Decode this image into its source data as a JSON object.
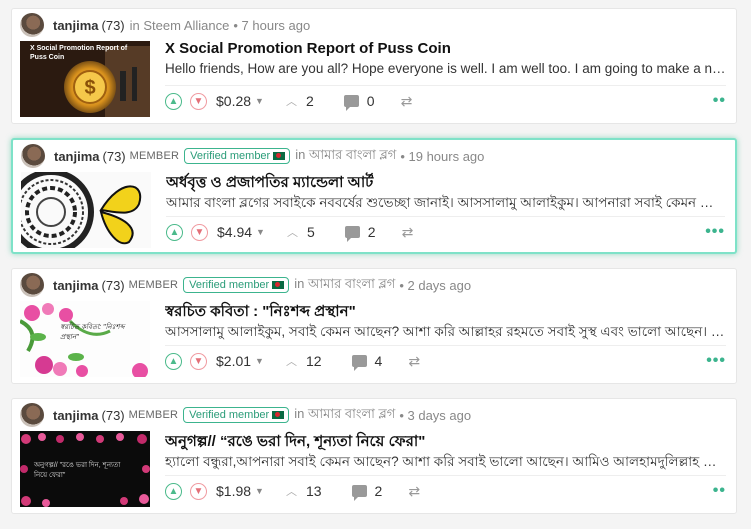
{
  "posts": [
    {
      "author": "tanjima",
      "reputation": "(73)",
      "member_label": "",
      "verified_label": "",
      "community_prefix": "in Steem Alliance",
      "time": "• 7 hours ago",
      "title": "X Social Promotion Report of Puss Coin",
      "body": "Hello friends, How are you all? Hope everyone is well. I am well too. I am going to make a new report on X social promotion of Puss Coin.",
      "thumb_caption": "X Social Promotion Report of Puss Coin",
      "payout": "$0.28",
      "votes": "2",
      "comments": "0",
      "more": "••"
    },
    {
      "author": "tanjima",
      "reputation": "(73)",
      "member_label": "MEMBER",
      "verified_label": "Verified member",
      "community_prefix": "in আমার বাংলা ব্লগ",
      "time": "• 19 hours ago",
      "title": "অর্ধবৃত্ত ও প্রজাপতির ম্যান্ডেলা আর্ট",
      "body": "আমার বাংলা ব্লগের সবাইকে নববর্ষের শুভেচ্ছা জানাই। আসসালামু আলাইকুম। আপনারা সবাই কেমন আছেন? আশা করি ভালো আছেন।",
      "thumb_caption": "",
      "payout": "$4.94",
      "votes": "5",
      "comments": "2",
      "more": "•••"
    },
    {
      "author": "tanjima",
      "reputation": "(73)",
      "member_label": "MEMBER",
      "verified_label": "Verified member",
      "community_prefix": "in আমার বাংলা ব্লগ",
      "time": "• 2 days ago",
      "title": "স্বরচিত কবিতা : \"নিঃশব্দ প্রস্থান\"",
      "body": "আসসালামু আলাইকুম, সবাই কেমন আছেন? আশা করি আল্লাহর রহমতে সবাই সুস্থ এবং ভালো আছেন। আলহামদুলিল্লাহ আমিও ভালো আছি।",
      "thumb_caption": "স্বরচিত কবিতা: \"নিঃশব্দ প্রস্থান\"",
      "payout": "$2.01",
      "votes": "12",
      "comments": "4",
      "more": "•••"
    },
    {
      "author": "tanjima",
      "reputation": "(73)",
      "member_label": "MEMBER",
      "verified_label": "Verified member",
      "community_prefix": "in আমার বাংলা ব্লগ",
      "time": "• 3 days ago",
      "title": "অনুগল্প// “রঙে ভরা দিন, শূন্যতা নিয়ে ফেরা\"",
      "body": "হ্যালো বন্ধুরা,আপনারা সবাই কেমন আছেন? আশা করি সবাই ভালো আছেন। আমিও আলহামদুলিল্লাহ ভালো আছি।",
      "thumb_caption": "অনুগল্প// \"রঙে ভরা দিন, শূন্যতা নিয়ে ফেরা\"",
      "payout": "$1.98",
      "votes": "13",
      "comments": "2",
      "more": "••"
    }
  ],
  "colors": {
    "accent_green": "#3cb48e",
    "downvote_red": "#e36f78",
    "active_border": "#7ee2c8"
  },
  "icons": {
    "upvote": "chevron-up-circle-icon",
    "downvote": "chevron-down-circle-icon",
    "votes": "chevron-up-icon",
    "comments": "comment-bubble-icon",
    "resteem": "resteem-arrows-icon"
  }
}
